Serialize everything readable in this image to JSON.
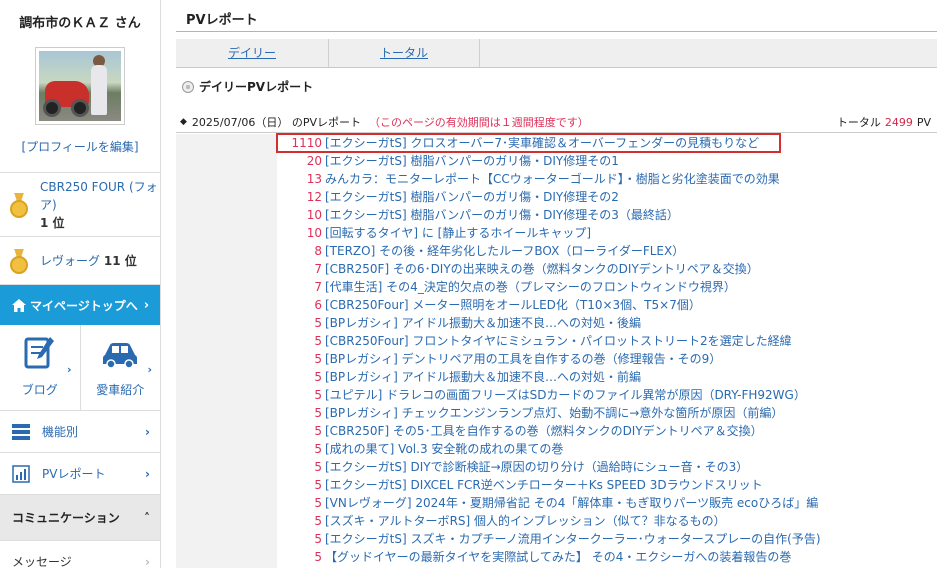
{
  "sidebar": {
    "user_name": "調布市のＫＡＺ さん",
    "edit_profile": "[プロフィールを編集]",
    "rankings": [
      {
        "text": "CBR250 FOUR (フォア)",
        "rank": "1 位"
      },
      {
        "text": "レヴォーグ",
        "rank": "11 位"
      }
    ],
    "mypage_top": "マイページトップへ",
    "tiles": [
      {
        "label": "ブログ",
        "icon": "blog-pencil-icon"
      },
      {
        "label": "愛車紹介",
        "icon": "car-icon"
      }
    ],
    "menu": [
      {
        "label": "機能別",
        "icon": "list-icon"
      },
      {
        "label": "PVレポート",
        "icon": "report-chart-icon"
      }
    ],
    "community_header": "コミュニケーション",
    "message": "メッセージ"
  },
  "main": {
    "page_title": "PVレポート",
    "tabs": [
      "デイリー",
      "トータル"
    ],
    "section_title": "デイリーPVレポート",
    "report": {
      "date_text": "2025/07/06（日） のPVレポート",
      "note": "（このページの有効期間は１週間程度です）",
      "total_label": "トータル",
      "total_value": "2499",
      "total_unit": "PV"
    },
    "rows": [
      {
        "count": "1110",
        "title": "[エクシーガtS] クロスオーバー7･実車確認＆オーバーフェンダーの見積もりなど"
      },
      {
        "count": "20",
        "title": "[エクシーガtS] 樹脂バンパーのガリ傷・DIY修理その1"
      },
      {
        "count": "13",
        "title": "みんカラ：モニターレポート【CCウォーターゴールド】・樹脂と劣化塗装面での効果"
      },
      {
        "count": "12",
        "title": "[エクシーガtS] 樹脂バンパーのガリ傷・DIY修理その2"
      },
      {
        "count": "10",
        "title": "[エクシーガtS] 樹脂バンパーのガリ傷・DIY修理その3（最終話）"
      },
      {
        "count": "10",
        "title": "[回転するタイヤ] に [静止するホイールキャップ]"
      },
      {
        "count": "8",
        "title": "[TERZO] その後・経年劣化したルーフBOX（ローライダーFLEX）"
      },
      {
        "count": "7",
        "title": "[CBR250F] その6･DIYの出来映えの巻（燃料タンクのDIYデントリペア＆交換）"
      },
      {
        "count": "7",
        "title": "[代車生活] その4_決定的欠点の巻（プレマシーのフロントウィンドウ視界）"
      },
      {
        "count": "6",
        "title": "[CBR250Four] メーター照明をオールLED化（T10×3個、T5×7個）"
      },
      {
        "count": "5",
        "title": "[BPレガシィ] アイドル振動大＆加速不良…への対処・後編"
      },
      {
        "count": "5",
        "title": "[CBR250Four] フロントタイヤにミシュラン・パイロットストリート2を選定した経緯"
      },
      {
        "count": "5",
        "title": "[BPレガシィ] デントリペア用の工具を自作するの巻（修理報告・その9）"
      },
      {
        "count": "5",
        "title": "[BPレガシィ] アイドル振動大＆加速不良…への対処・前編"
      },
      {
        "count": "5",
        "title": "[ユピテル] ドラレコの画面フリーズはSDカードのファイル異常が原因（DRY-FH92WG）"
      },
      {
        "count": "5",
        "title": "[BPレガシィ] チェックエンジンランプ点灯、始動不調に→意外な箇所が原因（前編）"
      },
      {
        "count": "5",
        "title": "[CBR250F] その5･工具を自作するの巻（燃料タンクのDIYデントリペア＆交換）"
      },
      {
        "count": "5",
        "title": "[成れの果て] Vol.3 安全靴の成れの果ての巻"
      },
      {
        "count": "5",
        "title": "[エクシーガtS] DIYで診断検証→原因の切り分け（過給時にシュー音・その3）"
      },
      {
        "count": "5",
        "title": "[エクシーガtS] DIXCEL FCR逆ベンチローター＋Ks SPEED 3Dラウンドスリット"
      },
      {
        "count": "5",
        "title": "[VNレヴォーグ] 2024年・夏期帰省記 その4「解体車・もぎ取りパーツ販売 ecoひろば」編"
      },
      {
        "count": "5",
        "title": "[スズキ・アルトターボRS] 個人的インプレッション（似て？非なるもの）"
      },
      {
        "count": "5",
        "title": "[エクシーガtS] スズキ・カプチーノ流用インタークーラー･ウォータースプレーの自作(予告)"
      },
      {
        "count": "5",
        "title": "【グッドイヤーの最新タイヤを実際試してみた】 その4・エクシーガへの装着報告の巻"
      }
    ]
  }
}
